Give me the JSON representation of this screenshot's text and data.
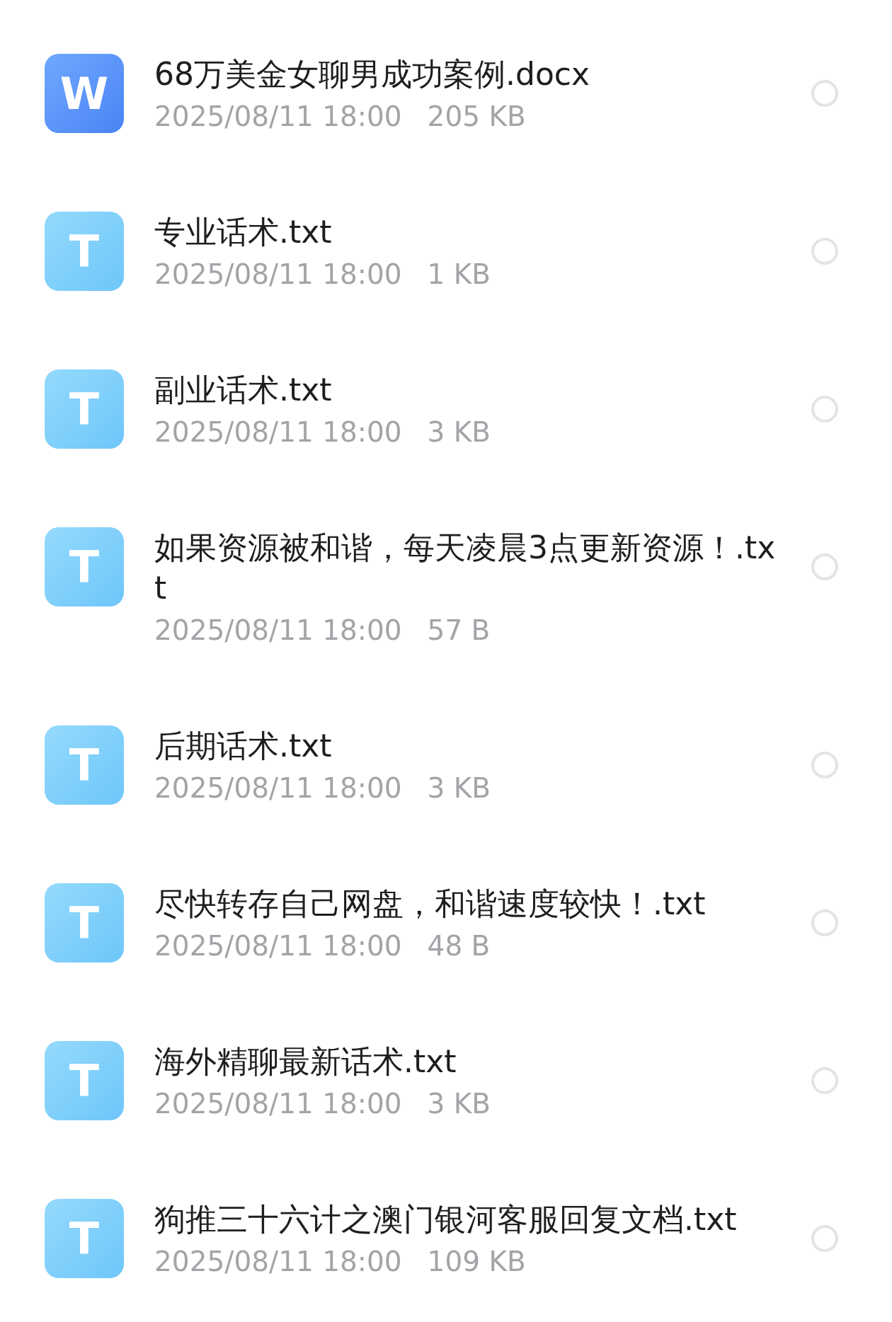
{
  "files": [
    {
      "kind": "word",
      "icon_letter": "W",
      "name": "68万美金女聊男成功案例.docx",
      "date": "2025/08/11 18:00",
      "size": "205 KB",
      "selected": false
    },
    {
      "kind": "text",
      "icon_letter": "T",
      "name": "专业话术.txt",
      "date": "2025/08/11 18:00",
      "size": "1 KB",
      "selected": false
    },
    {
      "kind": "text",
      "icon_letter": "T",
      "name": "副业话术.txt",
      "date": "2025/08/11 18:00",
      "size": "3 KB",
      "selected": false
    },
    {
      "kind": "text",
      "icon_letter": "T",
      "name": "如果资源被和谐，每天凌晨3点更新资源！.txt",
      "date": "2025/08/11 18:00",
      "size": "57 B",
      "selected": false
    },
    {
      "kind": "text",
      "icon_letter": "T",
      "name": "后期话术.txt",
      "date": "2025/08/11 18:00",
      "size": "3 KB",
      "selected": false
    },
    {
      "kind": "text",
      "icon_letter": "T",
      "name": "尽快转存自己网盘，和谐速度较快！.txt",
      "date": "2025/08/11 18:00",
      "size": "48 B",
      "selected": false
    },
    {
      "kind": "text",
      "icon_letter": "T",
      "name": "海外精聊最新话术.txt",
      "date": "2025/08/11 18:00",
      "size": "3 KB",
      "selected": false
    },
    {
      "kind": "text",
      "icon_letter": "T",
      "name": "狗推三十六计之澳门银河客服回复文档.txt",
      "date": "2025/08/11 18:00",
      "size": "109 KB",
      "selected": false
    }
  ]
}
